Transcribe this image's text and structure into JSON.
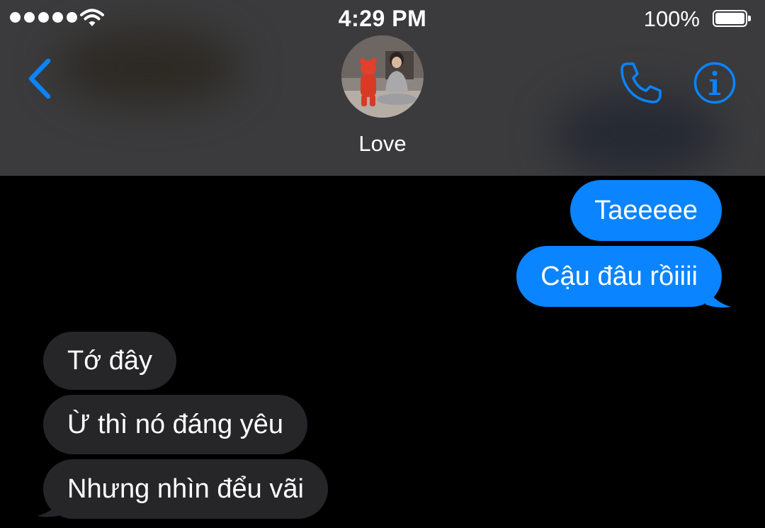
{
  "status_bar": {
    "time": "4:29 PM",
    "battery_percent": "100%",
    "signal_bars": 5
  },
  "nav": {
    "back_icon": "chevron-left-icon",
    "contact_name": "Love",
    "call_icon": "phone-icon",
    "info_icon": "info-icon"
  },
  "messages": [
    {
      "direction": "outgoing",
      "text": "Taeeeee"
    },
    {
      "direction": "outgoing",
      "text": "Cậu đâu rồiiii"
    },
    {
      "direction": "incoming",
      "text": "Tớ đây"
    },
    {
      "direction": "incoming",
      "text": "Ừ thì nó đáng yêu"
    },
    {
      "direction": "incoming",
      "text": "Nhưng nhìn đểu vãi"
    }
  ],
  "colors": {
    "accent": "#0a84ff",
    "header_bg": "#3b3b3d",
    "incoming_bubble": "#262629",
    "background": "#000000"
  }
}
